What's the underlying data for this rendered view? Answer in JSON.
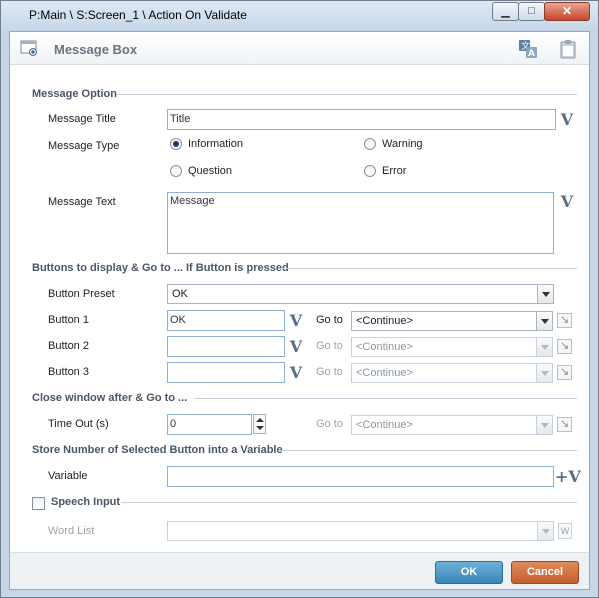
{
  "window": {
    "title": "P:Main \\ S:Screen_1 \\ Action On Validate",
    "minimize_glyph": "▁",
    "maximize_glyph": "□",
    "close_glyph": "✕"
  },
  "header": {
    "title": "Message Box"
  },
  "message_option": {
    "section_label": "Message Option",
    "title_label": "Message Title",
    "title_value": "Title",
    "type_label": "Message Type",
    "types": {
      "information": "Information",
      "warning": "Warning",
      "question": "Question",
      "error": "Error"
    },
    "selected_type": "Information",
    "text_label": "Message Text",
    "text_value": "Message"
  },
  "buttons_section": {
    "section_label": "Buttons to display & Go to ... If Button is pressed",
    "preset_label": "Button Preset",
    "preset_value": "OK",
    "goto_label": "Go to",
    "rows": [
      {
        "label": "Button 1",
        "value": "OK",
        "goto": "<Continue>"
      },
      {
        "label": "Button 2",
        "value": "",
        "goto": "<Continue>"
      },
      {
        "label": "Button 3",
        "value": "",
        "goto": "<Continue>"
      }
    ]
  },
  "close_section": {
    "section_label": "Close window after & Go to ...",
    "timeout_label": "Time Out (s)",
    "timeout_value": "0",
    "goto_label": "Go to",
    "goto_value": "<Continue>"
  },
  "store_section": {
    "section_label": "Store Number of Selected Button into a Variable",
    "variable_label": "Variable",
    "variable_value": ""
  },
  "speech_section": {
    "section_label": "Speech Input",
    "checked": false,
    "word_list_label": "Word List",
    "word_list_value": "",
    "w_button": "W"
  },
  "variable_button_glyph": "V",
  "add_variable_button_glyph": "+V",
  "footer": {
    "ok_label": "OK",
    "cancel_label": "Cancel"
  }
}
